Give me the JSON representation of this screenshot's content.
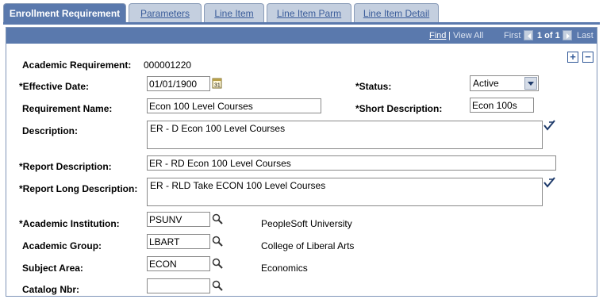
{
  "tabs": [
    {
      "label": "Enrollment Requirement",
      "active": true
    },
    {
      "label": "Parameters",
      "active": false
    },
    {
      "label": "Line Item",
      "active": false
    },
    {
      "label": "Line Item Parm",
      "active": false
    },
    {
      "label": "Line Item Detail",
      "active": false
    }
  ],
  "navbar": {
    "find": "Find",
    "separator": "|",
    "view_all": "View All",
    "first": "First",
    "position": "1 of 1",
    "last": "Last"
  },
  "controls": {
    "add": "+",
    "remove": "−"
  },
  "form": {
    "academic_requirement": {
      "label": "Academic Requirement:",
      "value": "000001220"
    },
    "effective_date": {
      "label": "*Effective Date:",
      "value": "01/01/1900"
    },
    "status": {
      "label": "*Status:",
      "value": "Active"
    },
    "requirement_name": {
      "label": "Requirement Name:",
      "value": "Econ 100 Level Courses"
    },
    "short_description": {
      "label": "*Short Description:",
      "value": "Econ 100s"
    },
    "description": {
      "label": "Description:",
      "value": "ER - D Econ 100 Level Courses"
    },
    "report_description": {
      "label": "*Report Description:",
      "value": "ER - RD  Econ 100 Level Courses"
    },
    "report_long_description": {
      "label": "*Report Long Description:",
      "value": "ER - RLD Take ECON 100 Level Courses"
    },
    "academic_institution": {
      "label": "*Academic Institution:",
      "value": "PSUNV",
      "description": "PeopleSoft University"
    },
    "academic_group": {
      "label": "Academic Group:",
      "value": "LBART",
      "description": "College of Liberal Arts"
    },
    "subject_area": {
      "label": "Subject Area:",
      "value": "ECON",
      "description": "Economics"
    },
    "catalog_nbr": {
      "label": "Catalog Nbr:",
      "value": ""
    }
  },
  "colors": {
    "header_blue": "#5a79ad",
    "tab_inactive": "#c4cfdf",
    "link": "#3a5c9a"
  },
  "icons": [
    "calendar-icon",
    "spellcheck-icon",
    "lookup-icon",
    "first-arrow-icon",
    "next-arrow-icon",
    "add-row-icon",
    "delete-row-icon"
  ]
}
